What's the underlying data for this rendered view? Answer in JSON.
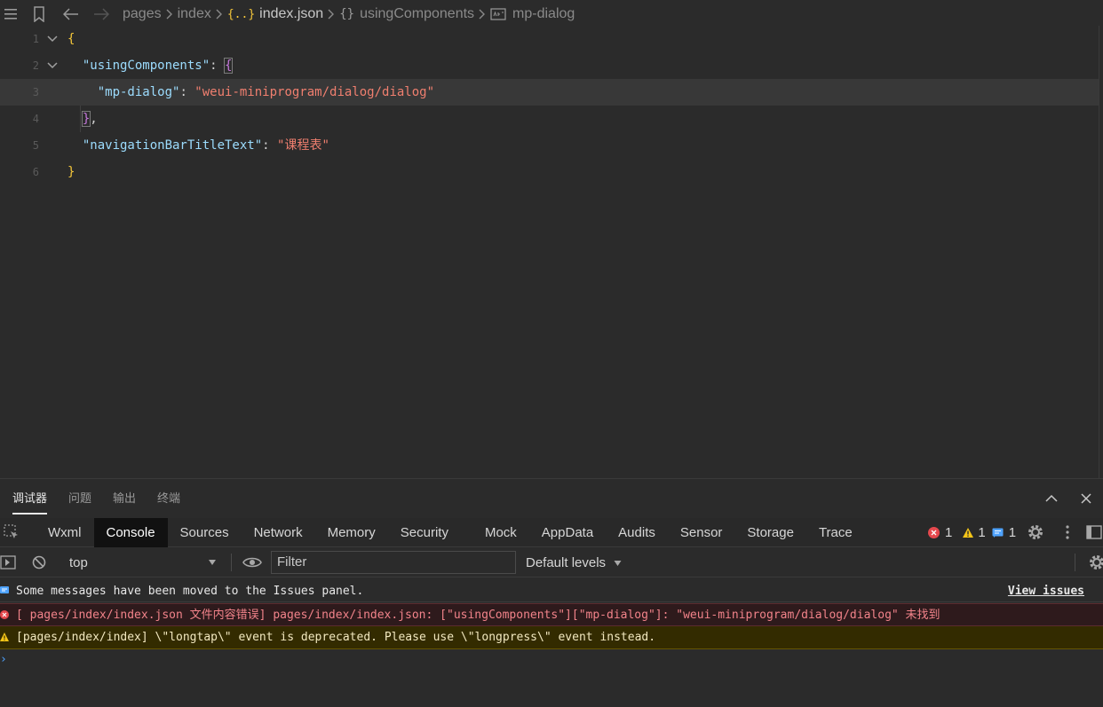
{
  "breadcrumb": {
    "items": [
      {
        "label": "pages"
      },
      {
        "label": "index"
      },
      {
        "label": "index.json",
        "icon": "json-braces-icon"
      },
      {
        "label": "usingComponents",
        "icon": "object-braces-icon"
      },
      {
        "label": "mp-dialog",
        "icon": "string-abc-icon"
      }
    ]
  },
  "editor": {
    "lines": [
      {
        "num": "1"
      },
      {
        "num": "2",
        "key": "\"usingComponents\"",
        "colon": ": "
      },
      {
        "num": "3",
        "key": "\"mp-dialog\"",
        "colon": ": ",
        "value": "\"weui-miniprogram/dialog/dialog\""
      },
      {
        "num": "4",
        "tail": ","
      },
      {
        "num": "5",
        "key": "\"navigationBarTitleText\"",
        "colon": ": ",
        "value": "\"课程表\""
      },
      {
        "num": "6"
      }
    ],
    "brace_open": "{",
    "brace_close": "}"
  },
  "panel": {
    "tabs": [
      "调试器",
      "问题",
      "输出",
      "终端"
    ]
  },
  "devtools": {
    "tabs": [
      "Wxml",
      "Console",
      "Sources",
      "Network",
      "Memory",
      "Security",
      "Mock",
      "AppData",
      "Audits",
      "Sensor",
      "Storage",
      "Trace"
    ],
    "error_count": "1",
    "warning_count": "1",
    "info_count": "1"
  },
  "console": {
    "context": "top",
    "filter_placeholder": "Filter",
    "levels": "Default levels",
    "messages": {
      "info": "Some messages have been moved to the Issues panel.",
      "view_issues": "View issues",
      "error": "[ pages/index/index.json 文件内容错误] pages/index/index.json: [\"usingComponents\"][\"mp-dialog\"]: \"weui-miniprogram/dialog/dialog\" 未找到",
      "warning": "[pages/index/index] \\\"longtap\\\" event is deprecated. Please use \\\"longpress\\\" event instead."
    },
    "prompt": "›"
  },
  "colors": {
    "error": "#e5484d",
    "warning": "#f5c518",
    "info": "#4fa3ff"
  }
}
